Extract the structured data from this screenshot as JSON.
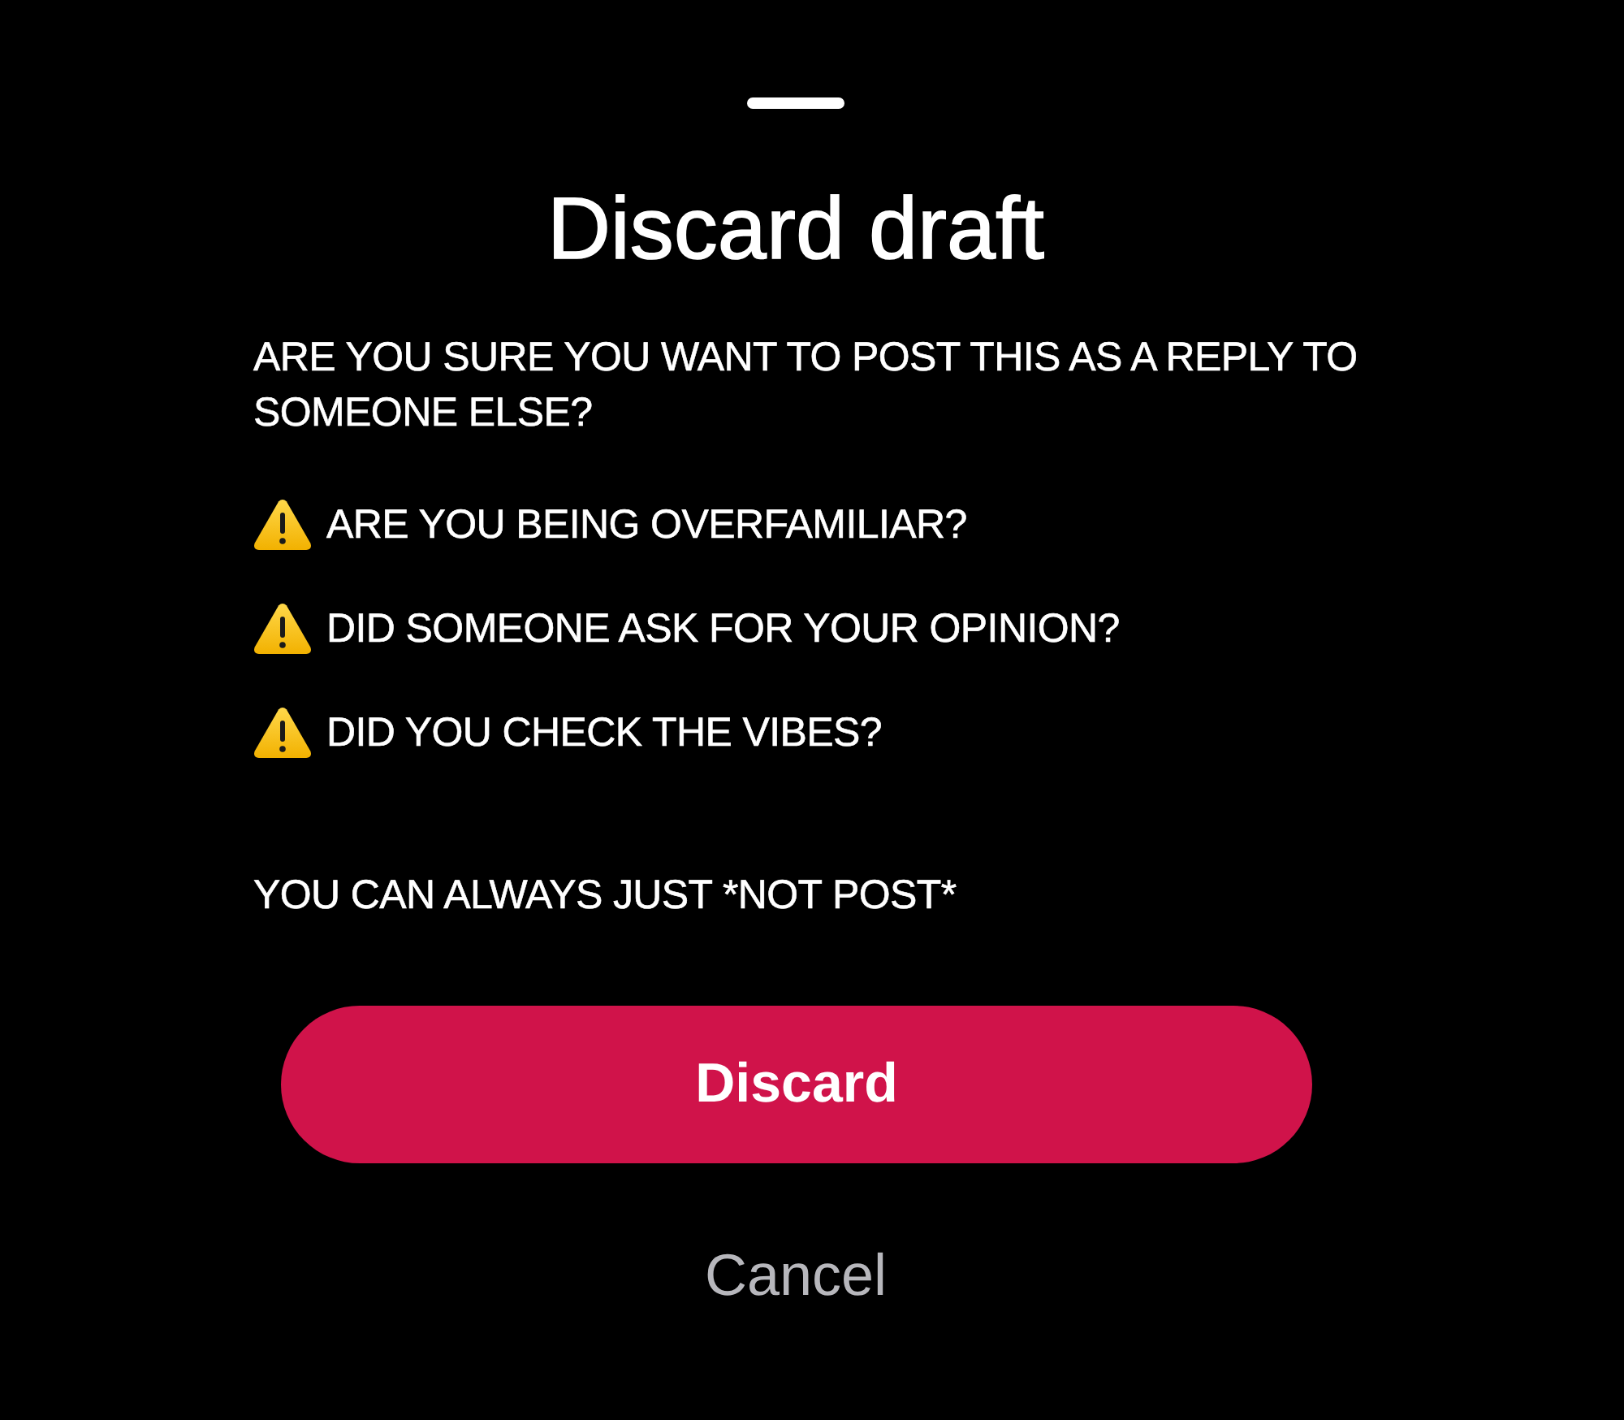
{
  "sheet": {
    "title": "Discard draft",
    "message": "ARE YOU SURE YOU WANT TO POST THIS AS A REPLY TO SOMEONE ELSE?",
    "warnings": [
      {
        "text": "ARE YOU BEING OVERFAMILIAR?"
      },
      {
        "text": "DID SOMEONE ASK FOR YOUR OPINION?"
      },
      {
        "text": "DID YOU CHECK THE VIBES?"
      }
    ],
    "footer_note": "YOU CAN ALWAYS JUST *NOT POST*",
    "buttons": [
      {
        "label": "Discard",
        "kind": "destructive"
      },
      {
        "label": "Cancel",
        "kind": "plain"
      }
    ]
  }
}
